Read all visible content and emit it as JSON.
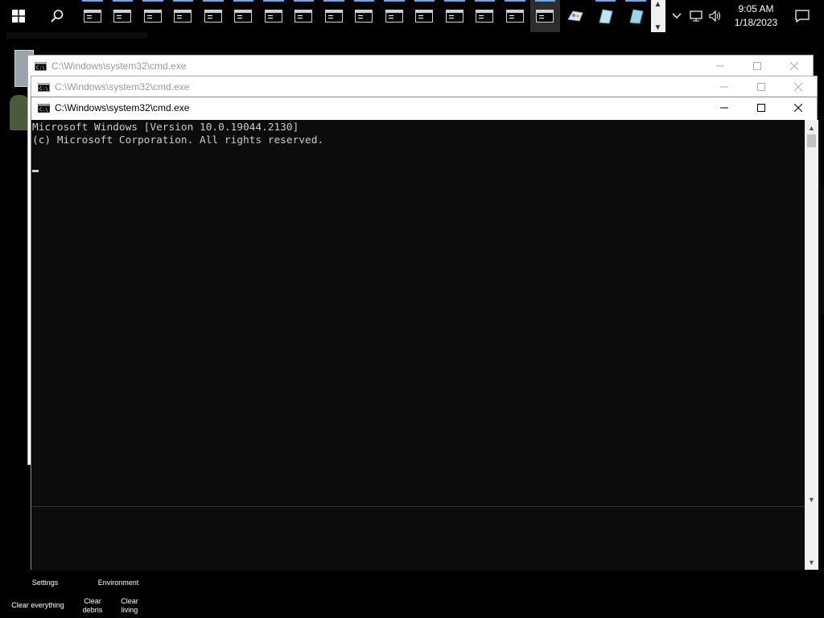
{
  "taskbar": {
    "app_count_cmd": 16,
    "clock": {
      "time": "9:05 AM",
      "date": "1/18/2023"
    }
  },
  "windows": [
    {
      "title": "C:\\Windows\\system32\\cmd.exe",
      "state": "inactive"
    },
    {
      "title": "C:\\Windows\\system32\\cmd.exe",
      "state": "inactive"
    },
    {
      "title": "C:\\Windows\\system32\\cmd.exe",
      "state": "active"
    }
  ],
  "console": {
    "line1": "Microsoft Windows [Version 10.0.19044.2130]",
    "line2": "(c) Microsoft Corporation. All rights reserved."
  },
  "hud": {
    "settings": "Settings",
    "environment": "Environment",
    "clear_everything": "Clear everything",
    "clear_debris": "Clear\ndebris",
    "clear_living": "Clear\nliving"
  },
  "colors": {
    "taskbar_bg": "#000000",
    "console_bg": "#0c0c0c",
    "console_fg": "#cccccc",
    "running_indicator": "#6aa8e8"
  }
}
